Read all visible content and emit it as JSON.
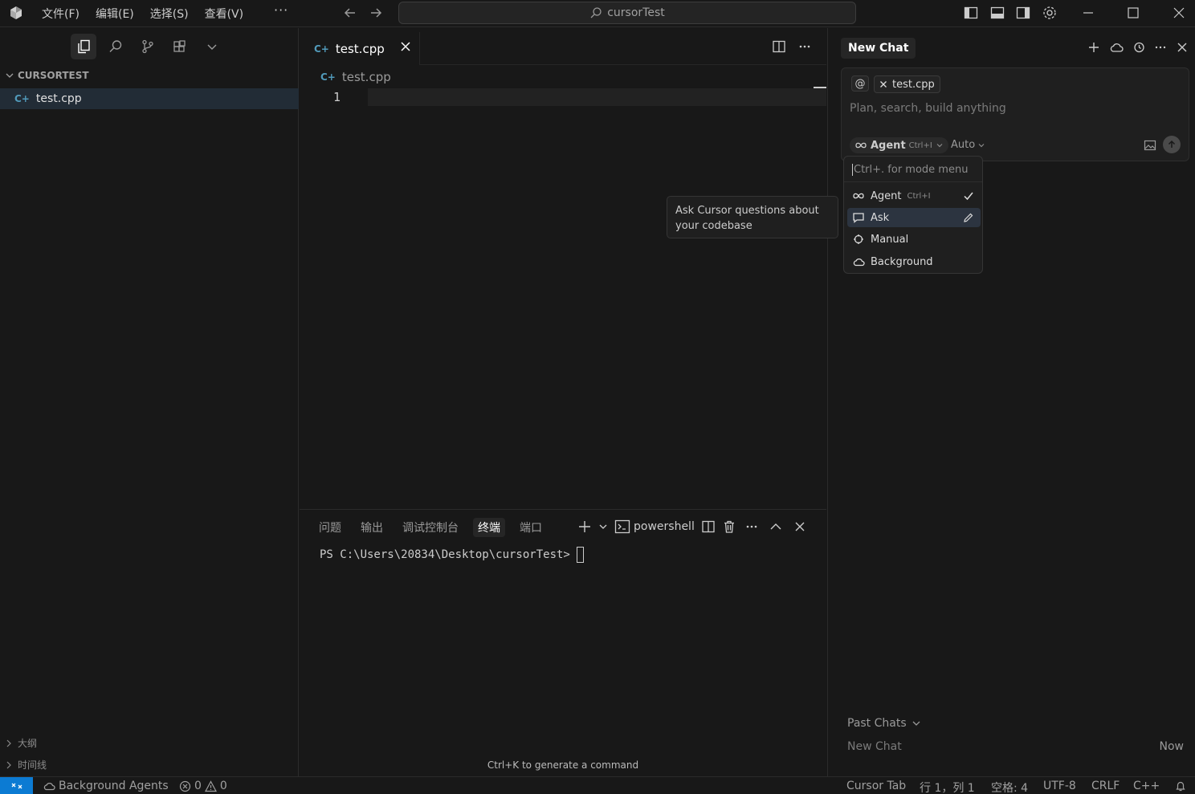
{
  "titlebar": {
    "menu": [
      "文件(F)",
      "编辑(E)",
      "选择(S)",
      "查看(V)"
    ],
    "more": "···",
    "search": "cursorTest"
  },
  "sidebar": {
    "explorer_title": "CURSORTEST",
    "files": [
      {
        "name": "test.cpp",
        "icon": "C++ file"
      }
    ],
    "bottom_sections": [
      "大纲",
      "时间线"
    ]
  },
  "editor": {
    "tab_label": "test.cpp",
    "breadcrumb": "test.cpp",
    "line_number": "1"
  },
  "panel": {
    "tabs": [
      "问题",
      "输出",
      "调试控制台",
      "终端",
      "端口"
    ],
    "active_tab": "终端",
    "terminal_name": "powershell",
    "prompt": "PS C:\\Users\\20834\\Desktop\\cursorTest>",
    "hint": "Ctrl+K to generate a command"
  },
  "chat": {
    "title": "New Chat",
    "at_symbol": "@",
    "context_file": "test.cpp",
    "placeholder": "Plan, search, build anything",
    "mode_label": "Agent",
    "mode_shortcut": "Ctrl+I",
    "model_label": "Auto",
    "mode_menu": {
      "search_placeholder": "Ctrl+. for mode menu",
      "items": [
        {
          "label": "Agent",
          "shortcut": "Ctrl+I",
          "selected": true
        },
        {
          "label": "Ask",
          "shortcut": "",
          "selected": false
        },
        {
          "label": "Manual",
          "shortcut": "",
          "selected": false
        },
        {
          "label": "Background",
          "shortcut": "",
          "selected": false
        }
      ]
    },
    "tooltip": "Ask Cursor questions about your codebase",
    "past_chats_label": "Past Chats",
    "past_chats": [
      {
        "title": "New Chat",
        "time": "Now"
      }
    ]
  },
  "statusbar": {
    "background_agents": "Background Agents",
    "errors": "0",
    "warnings": "0",
    "cursor_tab": "Cursor Tab",
    "position": "行 1，列 1",
    "spaces": "空格: 4",
    "encoding": "UTF-8",
    "eol": "CRLF",
    "language": "C++"
  },
  "colors": {
    "background": "#181818",
    "accent": "#0c7bd3",
    "cpp_icon": "#519aba"
  }
}
